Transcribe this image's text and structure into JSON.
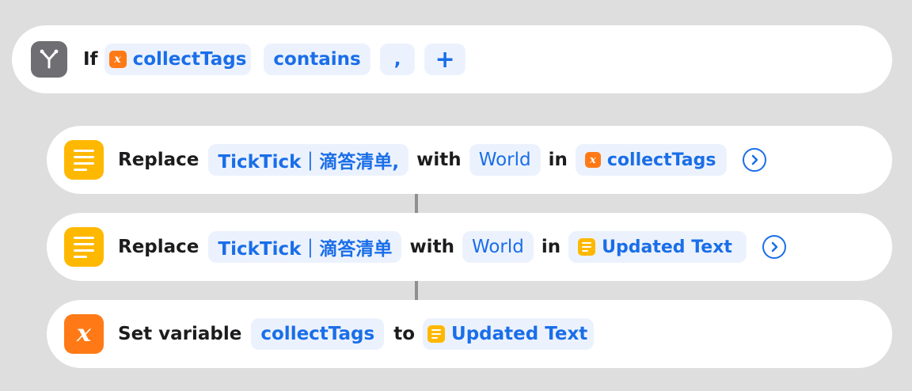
{
  "if_block": {
    "keyword": "If",
    "variable": "collectTags",
    "condition": "contains",
    "value": ",",
    "add": "+"
  },
  "action1": {
    "verb": "Replace",
    "find": "TickTick｜滴答清单,",
    "with_kw": "with",
    "replacement": "World",
    "in_kw": "in",
    "target": "collectTags"
  },
  "action2": {
    "verb": "Replace",
    "find": "TickTick｜滴答清单",
    "with_kw": "with",
    "replacement": "World",
    "in_kw": "in",
    "target": "Updated Text"
  },
  "action3": {
    "verb": "Set variable",
    "variable": "collectTags",
    "to_kw": "to",
    "value": "Updated Text"
  },
  "icons": {
    "if": "branch-icon",
    "text": "text-lines-icon",
    "variable": "variable-x-icon",
    "variable_glyph": "x",
    "chevron": "chevron-right-circle-icon"
  },
  "colors": {
    "accent": "#1a6ee8",
    "token_bg": "#ecf2fd",
    "text_icon": "#ffb800",
    "variable_icon": "#ff7a16",
    "if_icon": "#6e6e73"
  }
}
